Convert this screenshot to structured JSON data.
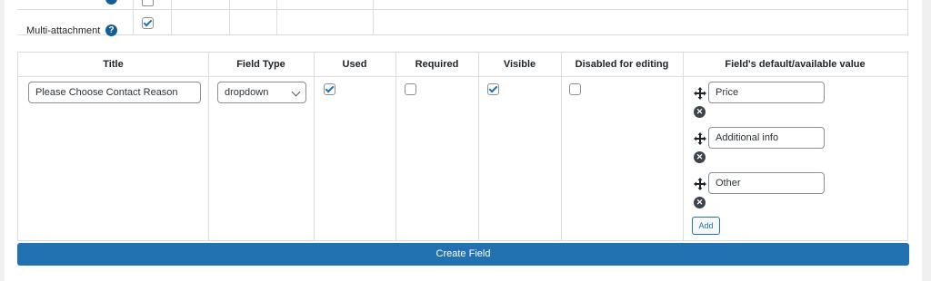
{
  "top_table": {
    "row_label": "Multi-attachment",
    "help_glyph": "?",
    "multi_attachment_checked": true
  },
  "headers": {
    "title": "Title",
    "field_type": "Field Type",
    "used": "Used",
    "required": "Required",
    "visible": "Visible",
    "disabled": "Disabled for editing",
    "default_value": "Field's default/available value"
  },
  "field": {
    "title_value": "Please Choose Contact Reason",
    "type_value": "dropdown",
    "used": true,
    "required": false,
    "visible": true,
    "disabled_for_editing": false,
    "options": [
      "Price",
      "Additional info",
      "Other"
    ]
  },
  "buttons": {
    "add_label": "Add",
    "create_label": "Create Field"
  },
  "icons": {
    "help": "help-icon",
    "move": "move-icon",
    "remove": "remove-icon",
    "chevron": "chevron-down-icon"
  },
  "colors": {
    "primary": "#2271b1",
    "help": "#135e96",
    "border": "#dcdcde",
    "background": "#f0f0f1"
  }
}
